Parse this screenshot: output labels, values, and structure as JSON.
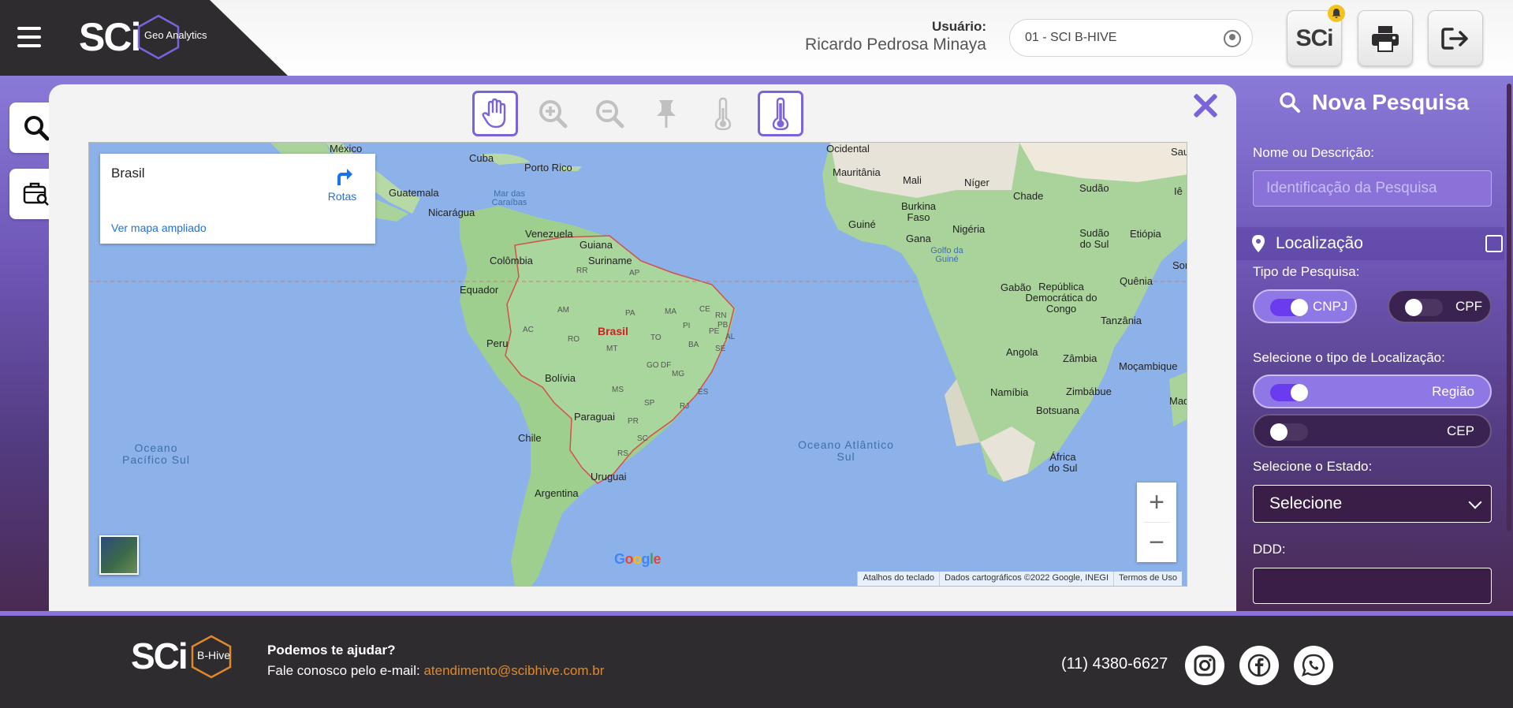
{
  "header": {
    "menu_icon": "hamburger-icon",
    "logo_text": "SCi",
    "logo_sub": "Geo Analytics",
    "user_label": "Usuário:",
    "user_name": "Ricardo Pedrosa Minaya",
    "company": "01 - SCI B-HIVE",
    "sci_button": "SCi",
    "notification_icon": "bell-icon",
    "print_icon": "printer-icon",
    "logout_icon": "logout-icon"
  },
  "toolbar": {
    "tools": [
      "pan-hand-icon",
      "zoom-in-icon",
      "zoom-out-icon",
      "pin-icon",
      "thermometer-icon",
      "thermometer-active-icon"
    ],
    "active_tools": [
      "pan-hand-icon",
      "thermometer-active-icon"
    ]
  },
  "map": {
    "card": {
      "place": "Brasil",
      "routes": "Rotas",
      "bigger_map": "Ver mapa ampliado"
    },
    "labels": {
      "mexico": "México",
      "cuba": "Cuba",
      "porto_rico": "Porto Rico",
      "guatemala": "Guatemala",
      "nicaragua": "Nicarágua",
      "mar_caraibas": "Mar das Caraíbas",
      "venezuela": "Venezuela",
      "guiana": "Guiana",
      "suriname": "Suriname",
      "colombia": "Colômbia",
      "equador": "Equador",
      "peru": "Peru",
      "brasil": "Brasil",
      "bolivia": "Bolívia",
      "paraguai": "Paraguai",
      "chile": "Chile",
      "uruguai": "Uruguai",
      "argentina": "Argentina",
      "pacifico": "Oceano Pacífico Sul",
      "atlantico": "Oceano Atlântico Sul",
      "ocidental": "Ocidental",
      "mauritania": "Mauritânia",
      "mali": "Mali",
      "niger": "Níger",
      "chade": "Chade",
      "sudao": "Sudão",
      "burkina": "Burkina Faso",
      "guine": "Guiné",
      "gana": "Gana",
      "nigeria": "Nigéria",
      "sudao_sul": "Sudão do Sul",
      "etiopia": "Etiópia",
      "golfo_guine": "Golfo da Guiné",
      "gabao": "Gabão",
      "rdc": "República Democrática do Congo",
      "quenia": "Quênia",
      "tanzania": "Tanzânia",
      "angola": "Angola",
      "zambia": "Zâmbia",
      "mocambique": "Moçambique",
      "namibia": "Namíbia",
      "zimbabue": "Zimbábue",
      "botsuana": "Botsuana",
      "africa_sul": "África do Sul",
      "madag": "Madag",
      "soma": "Somá",
      "saud": "Saud",
      "ie": "Iê"
    },
    "states": [
      "RR",
      "AP",
      "AM",
      "PA",
      "MA",
      "CE",
      "RN",
      "PB",
      "PE",
      "AL",
      "SE",
      "PI",
      "AC",
      "RO",
      "TO",
      "BA",
      "MT",
      "GO",
      "DF",
      "MG",
      "ES",
      "MS",
      "SP",
      "RJ",
      "PR",
      "SC",
      "RS"
    ],
    "zoom_in": "+",
    "zoom_out": "−",
    "google": "Google",
    "attrib_keyboard": "Atalhos do teclado",
    "attrib_data": "Dados cartográficos ©2022 Google, INEGI",
    "attrib_terms": "Termos de Uso"
  },
  "search_panel": {
    "title": "Nova Pesquisa",
    "name_label": "Nome ou Descrição:",
    "name_placeholder": "Identificação da Pesquisa",
    "location_label": "Localização",
    "type_label": "Tipo de Pesquisa:",
    "cnpj": "CNPJ",
    "cpf": "CPF",
    "cnpj_checked": true,
    "cpf_checked": false,
    "loc_type_label": "Selecione o tipo de Localização:",
    "regiao": "Região",
    "cep": "CEP",
    "regiao_checked": true,
    "cep_checked": false,
    "state_label": "Selecione o Estado:",
    "state_value": "Selecione",
    "ddd_label": "DDD:"
  },
  "footer": {
    "logo_text": "SCi",
    "logo_sub": "B-Hive",
    "help_question": "Podemos te ajudar?",
    "help_text": "Fale conosco pelo e-mail:",
    "email": "atendimento@scibhive.com.br",
    "phone": "(11) 4380-6627",
    "social": [
      "instagram-icon",
      "facebook-icon",
      "whatsapp-icon"
    ]
  },
  "colors": {
    "accent": "#7c63dc",
    "header_dark": "#2e2c2f",
    "email": "#e0892b",
    "map_water": "#8cb2e9",
    "map_land": "#a8d5a2"
  }
}
